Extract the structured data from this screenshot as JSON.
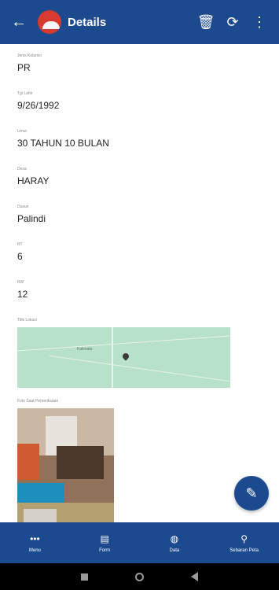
{
  "header": {
    "back_icon": "arrow-left-icon",
    "title": "Details",
    "actions": [
      {
        "icon": "trash-icon",
        "glyph": "🗑"
      },
      {
        "icon": "refresh-icon",
        "glyph": "⟳"
      },
      {
        "icon": "more-vert-icon",
        "glyph": "⋮"
      }
    ]
  },
  "fields": [
    {
      "label": "Jenis Kelamin",
      "value": "PR"
    },
    {
      "label": "Tgl Lahir",
      "value": "9/26/1992"
    },
    {
      "label": "Umur",
      "value": "30 TAHUN 10 BULAN"
    },
    {
      "label": "Desa",
      "value": "HARAY"
    },
    {
      "label": "Dusun",
      "value": "Palindi"
    },
    {
      "label": "RT",
      "value": "6"
    },
    {
      "label": "RW",
      "value": "12"
    }
  ],
  "map": {
    "label": "Titik Lokasi",
    "place": "Kalimata"
  },
  "photo": {
    "label": "Foto Saat Pemeriksaan"
  },
  "fab": {
    "icon": "edit-icon",
    "glyph": "✎"
  },
  "bottom_nav": [
    {
      "label": "Menu",
      "icon": "more-horiz-icon",
      "glyph": "•••"
    },
    {
      "label": "Form",
      "icon": "document-icon",
      "glyph": "▤"
    },
    {
      "label": "Data",
      "icon": "globe-icon",
      "glyph": "◍"
    },
    {
      "label": "Sebaran Peta",
      "icon": "map-pin-icon",
      "glyph": "⚲"
    }
  ],
  "colors": {
    "primary": "#1b4a8f",
    "map": "#b7e1c9"
  }
}
